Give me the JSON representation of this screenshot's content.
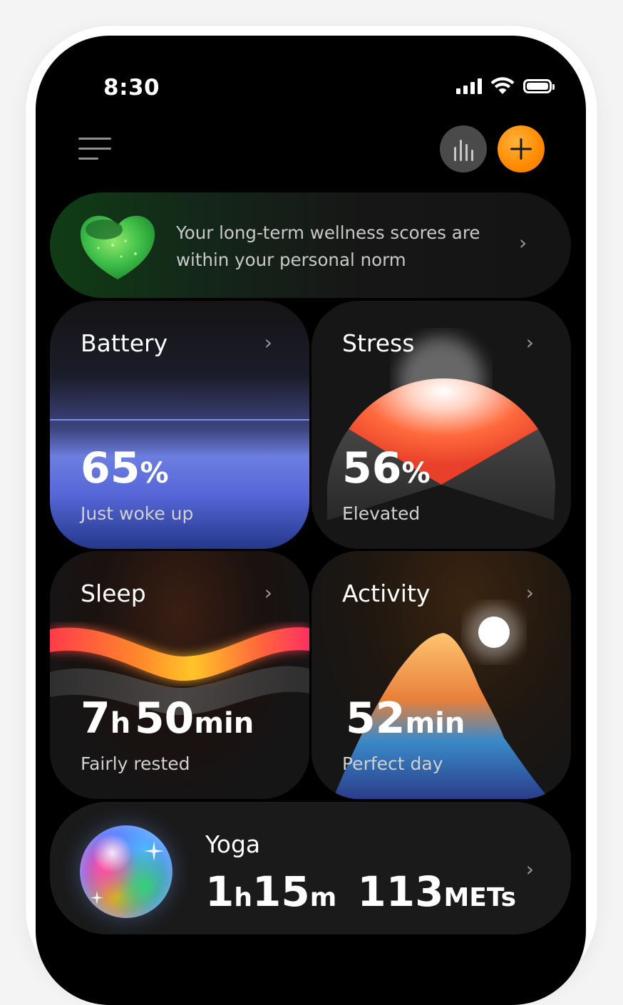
{
  "status_bar": {
    "time": "8:30"
  },
  "header": {
    "stats_icon": "bar-chart-icon",
    "add_icon": "plus-icon",
    "menu_icon": "menu-icon"
  },
  "banner": {
    "text": "Your long-term wellness scores are within your personal norm",
    "icon": "heart-icon",
    "accent": "#3fbf4a"
  },
  "cards": {
    "battery": {
      "title": "Battery",
      "value": "65",
      "unit": "%",
      "status": "Just woke up",
      "level_fraction": 0.65,
      "accent": "#6b7ee3"
    },
    "stress": {
      "title": "Stress",
      "value": "56",
      "unit": "%",
      "status": "Elevated",
      "level_fraction": 0.56,
      "accent": "#ff5a3a"
    },
    "sleep": {
      "title": "Sleep",
      "hours": "7",
      "hours_unit": "h",
      "minutes": "50",
      "minutes_unit": "min",
      "status": "Fairly rested",
      "accent": "#ffb02e"
    },
    "activity": {
      "title": "Activity",
      "value": "52",
      "unit": "min",
      "status": "Perfect day",
      "accent": "#ff8a2a"
    }
  },
  "yoga": {
    "title": "Yoga",
    "duration_h": "1",
    "duration_h_unit": "h",
    "duration_m": "15",
    "duration_m_unit": "m",
    "mets": "113",
    "mets_unit": "METs"
  }
}
